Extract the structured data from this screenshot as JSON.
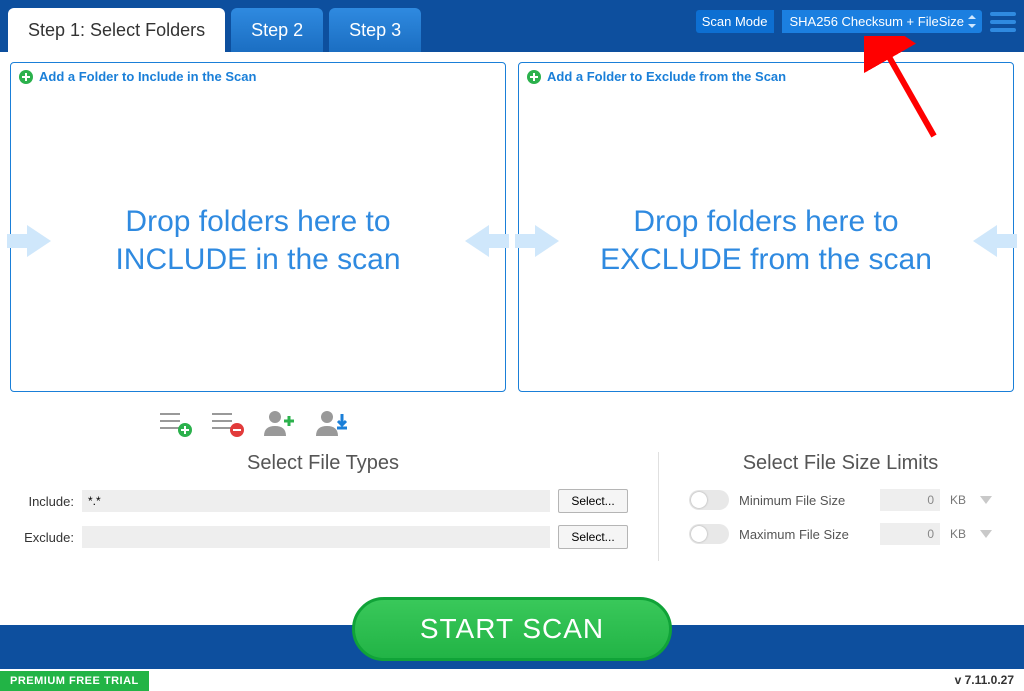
{
  "tabs": {
    "step1": "Step 1: Select Folders",
    "step2": "Step 2",
    "step3": "Step 3"
  },
  "scanMode": {
    "label": "Scan Mode",
    "value": "SHA256 Checksum + FileSize"
  },
  "include": {
    "addLabel": "Add a Folder to Include in the Scan",
    "dropText": "Drop folders here to INCLUDE in the scan"
  },
  "exclude": {
    "addLabel": "Add a Folder to Exclude from the Scan",
    "dropText": "Drop folders here to EXCLUDE from the scan"
  },
  "fileTypes": {
    "title": "Select File Types",
    "includeLabel": "Include:",
    "excludeLabel": "Exclude:",
    "includeValue": "*.*",
    "excludeValue": "",
    "selectBtn": "Select..."
  },
  "fileSize": {
    "title": "Select File Size Limits",
    "minLabel": "Minimum File Size",
    "maxLabel": "Maximum File Size",
    "minValue": "0",
    "maxValue": "0",
    "unit": "KB"
  },
  "startBtn": "START SCAN",
  "trialBadge": "PREMIUM FREE TRIAL",
  "version": "v 7.11.0.27"
}
